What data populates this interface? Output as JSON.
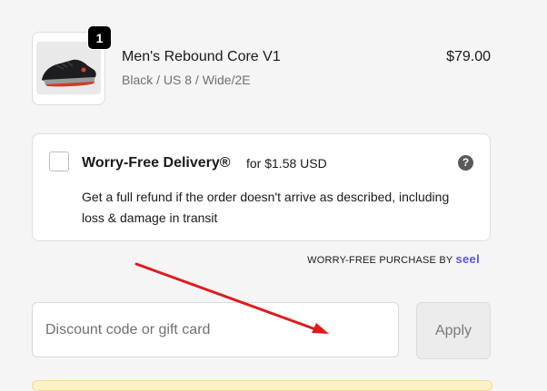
{
  "cart_item": {
    "quantity": "1",
    "name": "Men's Rebound Core V1",
    "variant": "Black / US 8 / Wide/2E",
    "price": "$79.00"
  },
  "worry_free": {
    "title": "Worry-Free Delivery®",
    "price_text": "for $1.58 USD",
    "help_glyph": "?",
    "description": "Get a full refund if the order doesn't arrive as described, including loss & damage in transit",
    "checked": false
  },
  "seel": {
    "label": "WORRY-FREE PURCHASE BY",
    "brand": "seel",
    "brand_color": "#5a5bd6"
  },
  "discount": {
    "placeholder": "Discount code or gift card",
    "value": "",
    "apply_label": "Apply"
  },
  "annotation": {
    "color": "#e01b1b",
    "icon": "red-arrow"
  }
}
